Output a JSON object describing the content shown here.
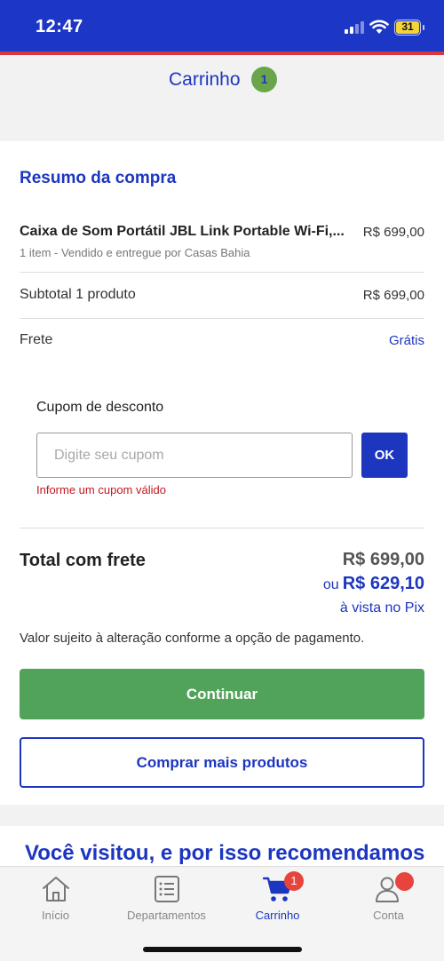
{
  "status_bar": {
    "time": "12:47",
    "battery": "31"
  },
  "header": {
    "title": "Carrinho",
    "badge": "1"
  },
  "summary": {
    "title": "Resumo da compra",
    "product": {
      "name": "Caixa de Som Portátil JBL Link Portable Wi-Fi,...",
      "price": "R$ 699,00",
      "subtitle": "1 item - Vendido e entregue por Casas Bahia"
    },
    "subtotal": {
      "label": "Subtotal 1 produto",
      "value": "R$ 699,00"
    },
    "shipping": {
      "label": "Frete",
      "value": "Grátis"
    }
  },
  "coupon": {
    "label": "Cupom de desconto",
    "placeholder": "Digite seu cupom",
    "value": "",
    "button": "OK",
    "error": "Informe um cupom válido"
  },
  "total": {
    "label": "Total com frete",
    "price": "R$ 699,00",
    "pix_prefix": "ou",
    "pix_price": "R$ 629,10",
    "pix_subtitle": "à vista no Pix",
    "note": "Valor sujeito à alteração conforme a opção de pagamento."
  },
  "actions": {
    "continue": "Continuar",
    "more": "Comprar mais produtos"
  },
  "recommendations": {
    "title": "Você visitou, e por isso recomendamos"
  },
  "tabbar": {
    "items": [
      {
        "label": "Início",
        "icon": "home-icon"
      },
      {
        "label": "Departamentos",
        "icon": "list-icon"
      },
      {
        "label": "Carrinho",
        "icon": "cart-icon",
        "badge": "1",
        "active": true
      },
      {
        "label": "Conta",
        "icon": "user-icon"
      }
    ]
  },
  "colors": {
    "brand": "#1d36c0",
    "status_bar": "#1c36c6",
    "accent_red": "#d8363e",
    "success": "#52a35a",
    "error": "#c4161c"
  }
}
